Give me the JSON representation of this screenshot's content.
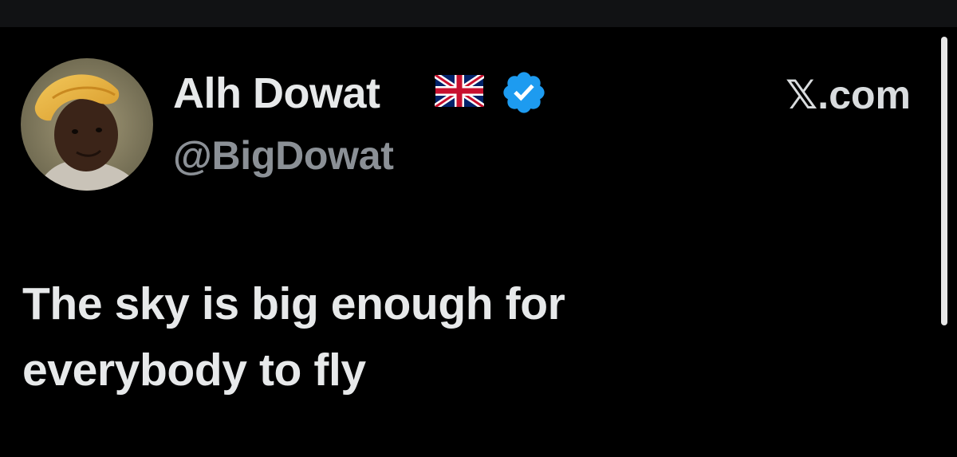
{
  "author": {
    "display_name": "Alh Dowat",
    "handle": "@BigDowat",
    "flag_icon": "uk-flag-icon",
    "verified_icon": "verified-badge-icon",
    "verified_color": "#1d9bf0"
  },
  "source": {
    "label": "𝕏.com"
  },
  "tweet": {
    "lines": [
      "The sky is big enough for",
      "everybody to fly"
    ]
  },
  "theme": {
    "background": "#000000",
    "text_primary": "#e7e9ea",
    "text_secondary": "#8b9096"
  }
}
